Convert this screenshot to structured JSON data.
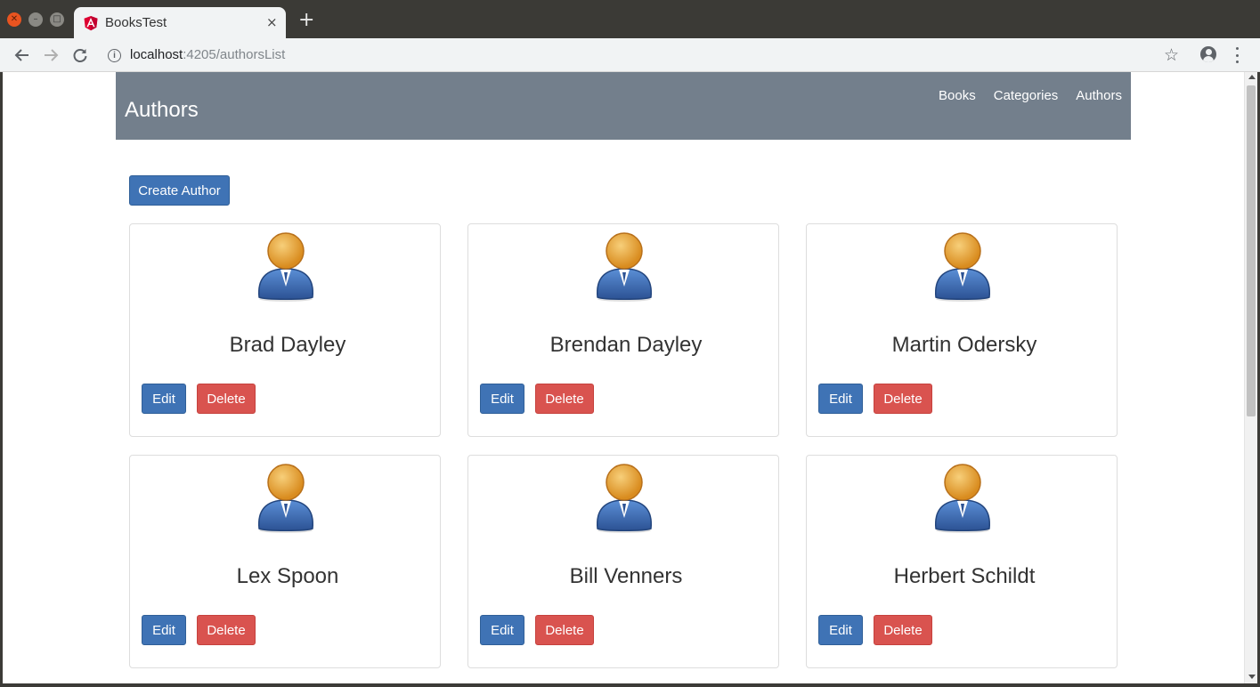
{
  "browser": {
    "tab_title": "BooksTest",
    "tab_close": "×",
    "new_tab": "+",
    "url_host": "localhost",
    "url_rest": ":4205/authorsList",
    "star": "☆",
    "info": "i"
  },
  "header": {
    "title": "Authors",
    "nav": [
      "Books",
      "Categories",
      "Authors"
    ]
  },
  "create_button_label": "Create Author",
  "authors": [
    {
      "name": "Brad Dayley"
    },
    {
      "name": "Brendan Dayley"
    },
    {
      "name": "Martin Odersky"
    },
    {
      "name": "Lex Spoon"
    },
    {
      "name": "Bill Venners"
    },
    {
      "name": "Herbert Schildt"
    }
  ],
  "card_buttons": {
    "edit": "Edit",
    "delete": "Delete"
  },
  "colors": {
    "header_bg": "#737f8c",
    "primary": "#3f73b5",
    "danger": "#d9534f",
    "avatar_head": "#e8a23a",
    "avatar_body": "#3d6db1"
  },
  "icons": [
    "angular-favicon",
    "back-arrow-icon",
    "forward-arrow-icon",
    "reload-icon",
    "info-icon",
    "star-icon",
    "profile-icon",
    "menu-icon",
    "user-avatar-icon"
  ]
}
